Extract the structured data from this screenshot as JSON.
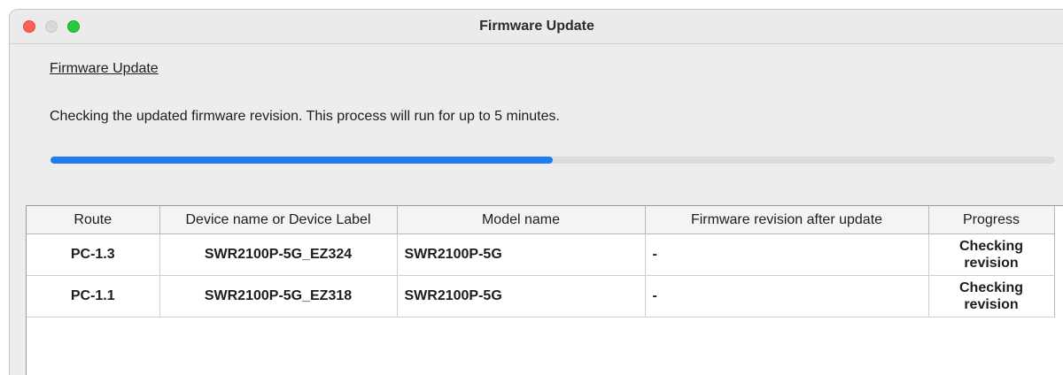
{
  "window": {
    "title": "Firmware Update"
  },
  "page": {
    "heading": "Firmware Update",
    "message": "Checking the updated firmware revision. This process will run for up to 5 minutes.",
    "progress_fraction": 0.5
  },
  "table": {
    "columns": [
      "Route",
      "Device name or Device Label",
      "Model name",
      "Firmware revision after update",
      "Progress"
    ],
    "rows": [
      {
        "route": "PC-1.3",
        "device": "SWR2100P-5G_EZ324",
        "model": "SWR2100P-5G",
        "firmware": "-",
        "progress_line1": "Checking",
        "progress_line2": "revision"
      },
      {
        "route": "PC-1.1",
        "device": "SWR2100P-5G_EZ318",
        "model": "SWR2100P-5G",
        "firmware": "-",
        "progress_line1": "Checking",
        "progress_line2": "revision"
      }
    ]
  },
  "colors": {
    "accent": "#1f7cf0",
    "close": "#ff5f57",
    "minimize": "#d9d9d9",
    "maximize": "#28c840"
  },
  "icons": [
    "close-window-icon",
    "minimize-window-icon",
    "maximize-window-icon"
  ]
}
